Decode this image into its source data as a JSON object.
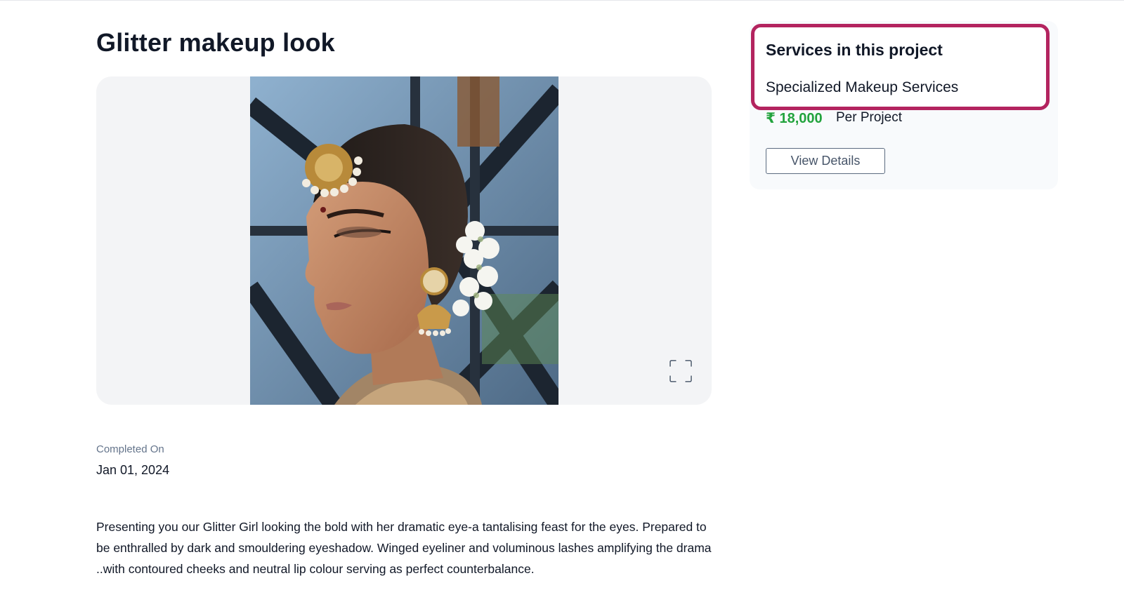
{
  "project": {
    "title": "Glitter makeup look",
    "completed_label": "Completed On",
    "completed_date": "Jan 01, 2024",
    "description": "Presenting you our Glitter Girl looking the bold with her dramatic eye-a tantalising feast for the eyes. Prepared to be enthralled by dark and smouldering eyeshadow. Winged eyeliner and voluminous lashes amplifying the drama ..with contoured cheeks and neutral lip colour serving as perfect counterbalance."
  },
  "gallery": {
    "expand_icon": "fullscreen-icon"
  },
  "services": {
    "title": "Services in this project",
    "service_name": "Specialized Makeup Services",
    "price": "₹ 18,000",
    "price_unit": "Per Project",
    "view_details_label": "View Details"
  },
  "colors": {
    "highlight_border": "#b3245f",
    "price": "#22a33d",
    "card_background": "#f8fafc"
  }
}
